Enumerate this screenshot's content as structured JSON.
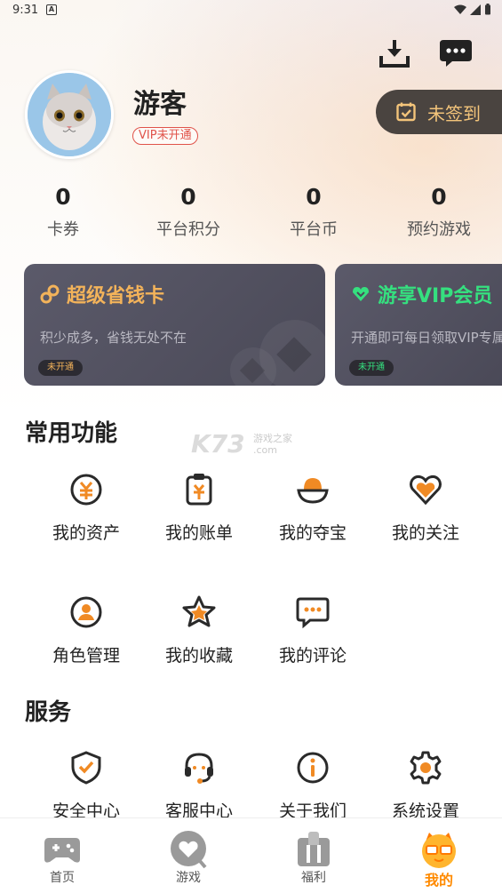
{
  "status_bar": {
    "time": "9:31",
    "notification": "A"
  },
  "profile": {
    "username": "游客",
    "vip_status": "VIP未开通",
    "checkin_label": "未签到"
  },
  "stats": [
    {
      "value": "0",
      "label": "卡券"
    },
    {
      "value": "0",
      "label": "平台积分"
    },
    {
      "value": "0",
      "label": "平台币"
    },
    {
      "value": "0",
      "label": "预约游戏"
    }
  ],
  "cards": [
    {
      "title": "超级省钱卡",
      "desc": "积少成多，省钱无处不在",
      "badge": "未开通",
      "accent": "#f3b35a"
    },
    {
      "title": "游享VIP会员",
      "desc": "开通即可每日领取VIP专属礼包",
      "badge": "未开通",
      "accent": "#35e07f"
    }
  ],
  "sections": {
    "common": {
      "title": "常用功能",
      "items": [
        {
          "label": "我的资产",
          "icon": "yen-coin-icon"
        },
        {
          "label": "我的账单",
          "icon": "bill-icon"
        },
        {
          "label": "我的夺宝",
          "icon": "treasure-icon"
        },
        {
          "label": "我的关注",
          "icon": "heart-icon"
        },
        {
          "label": "角色管理",
          "icon": "person-icon"
        },
        {
          "label": "我的收藏",
          "icon": "star-icon"
        },
        {
          "label": "我的评论",
          "icon": "comment-icon"
        }
      ]
    },
    "service": {
      "title": "服务",
      "items": [
        {
          "label": "安全中心",
          "icon": "shield-icon"
        },
        {
          "label": "客服中心",
          "icon": "headset-icon"
        },
        {
          "label": "关于我们",
          "icon": "info-icon"
        },
        {
          "label": "系统设置",
          "icon": "gear-icon"
        }
      ]
    }
  },
  "watermark": {
    "main": "K73",
    "sub1": "游戏之家",
    "sub2": ".com"
  },
  "bottom_nav": [
    {
      "label": "首页",
      "icon": "gamepad-icon",
      "active": false
    },
    {
      "label": "游戏",
      "icon": "game-heart-icon",
      "active": false
    },
    {
      "label": "福利",
      "icon": "gift-icon",
      "active": false
    },
    {
      "label": "我的",
      "icon": "mascot-icon",
      "active": true
    }
  ],
  "colors": {
    "accent": "#ff8a00",
    "icon_orange": "#f08a24",
    "icon_dark": "#2a2a2a",
    "vip_red": "#e0534a"
  }
}
